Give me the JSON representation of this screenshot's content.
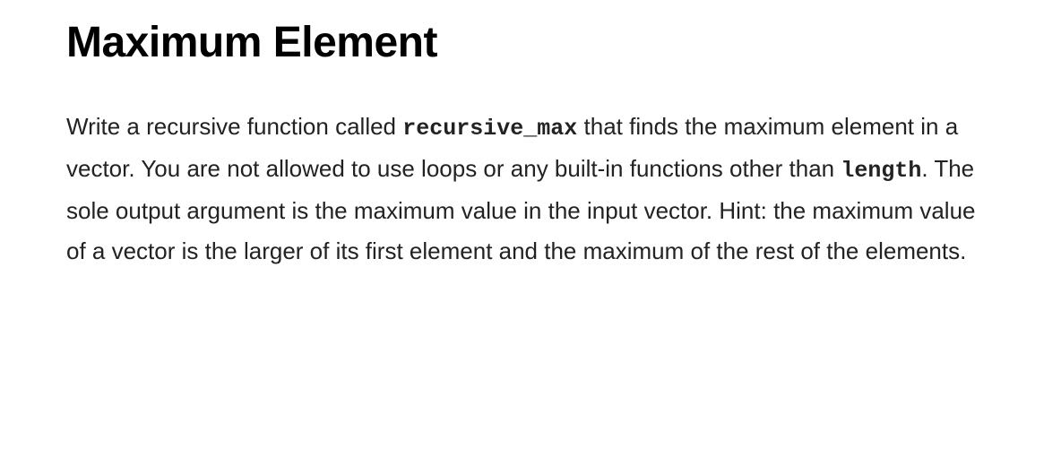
{
  "title": "Maximum Element",
  "body": {
    "part1": "Write a recursive function called ",
    "code1": "recursive_max",
    "part2": " that finds the maximum element in a vector. You are not allowed to use loops or any built-in functions other than ",
    "code2": "length",
    "part3": ". The sole output argument is the maximum value in the input vector. Hint: the maximum value of a vector is the larger of its first element and the maximum of the rest of the elements."
  }
}
